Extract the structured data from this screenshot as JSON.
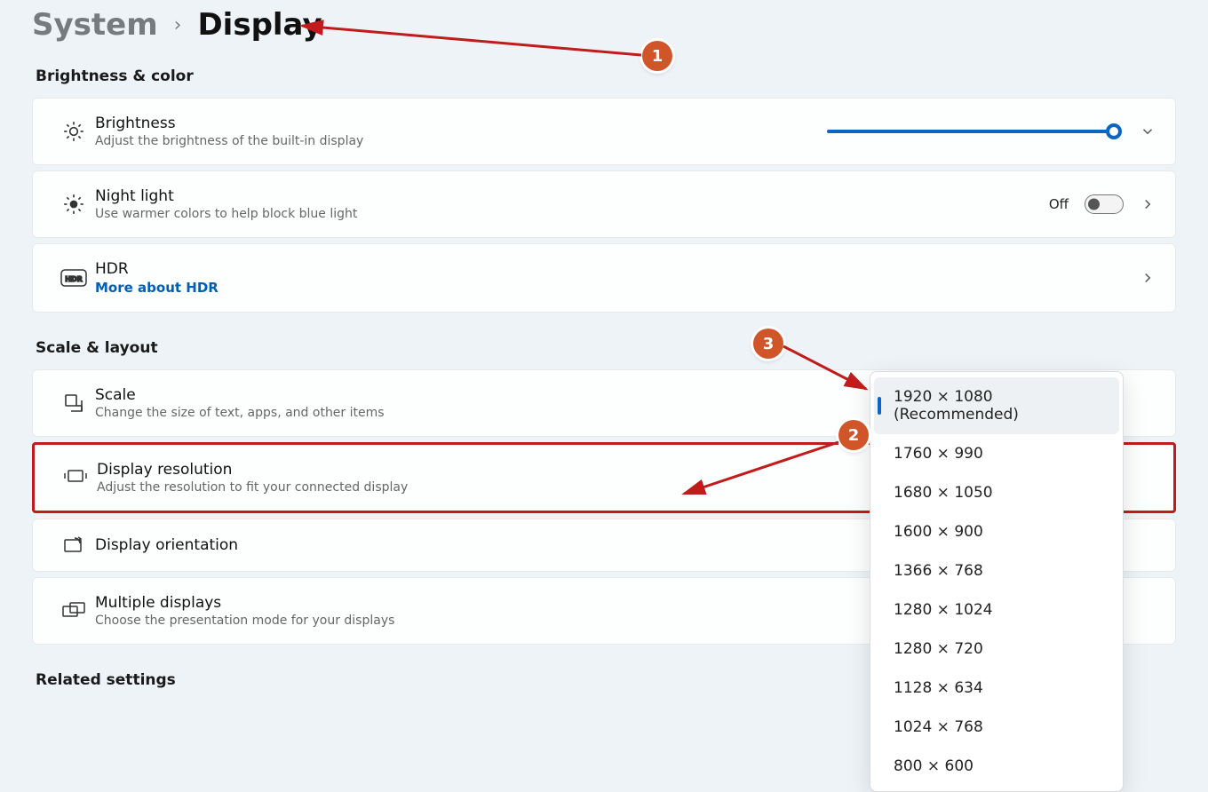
{
  "breadcrumb": {
    "parent": "System",
    "current": "Display"
  },
  "sections": {
    "brightness_color": "Brightness & color",
    "scale_layout": "Scale & layout",
    "related": "Related settings"
  },
  "brightness": {
    "title": "Brightness",
    "sub": "Adjust the brightness of the built-in display",
    "value_percent": 98
  },
  "night_light": {
    "title": "Night light",
    "sub": "Use warmer colors to help block blue light",
    "state_label": "Off",
    "state": false
  },
  "hdr": {
    "title": "HDR",
    "link": "More about HDR"
  },
  "scale": {
    "title": "Scale",
    "sub": "Change the size of text, apps, and other items"
  },
  "resolution": {
    "title": "Display resolution",
    "sub": "Adjust the resolution to fit your connected display",
    "options": [
      "1920 × 1080 (Recommended)",
      "1760 × 990",
      "1680 × 1050",
      "1600 × 900",
      "1366 × 768",
      "1280 × 1024",
      "1280 × 720",
      "1128 × 634",
      "1024 × 768",
      "800 × 600"
    ],
    "selected_index": 0
  },
  "orientation": {
    "title": "Display orientation"
  },
  "multiple": {
    "title": "Multiple displays",
    "sub": "Choose the presentation mode for your displays"
  },
  "annotations": {
    "1": "breadcrumb-display",
    "2": "display-resolution-row",
    "3": "resolution-option-recommended"
  }
}
